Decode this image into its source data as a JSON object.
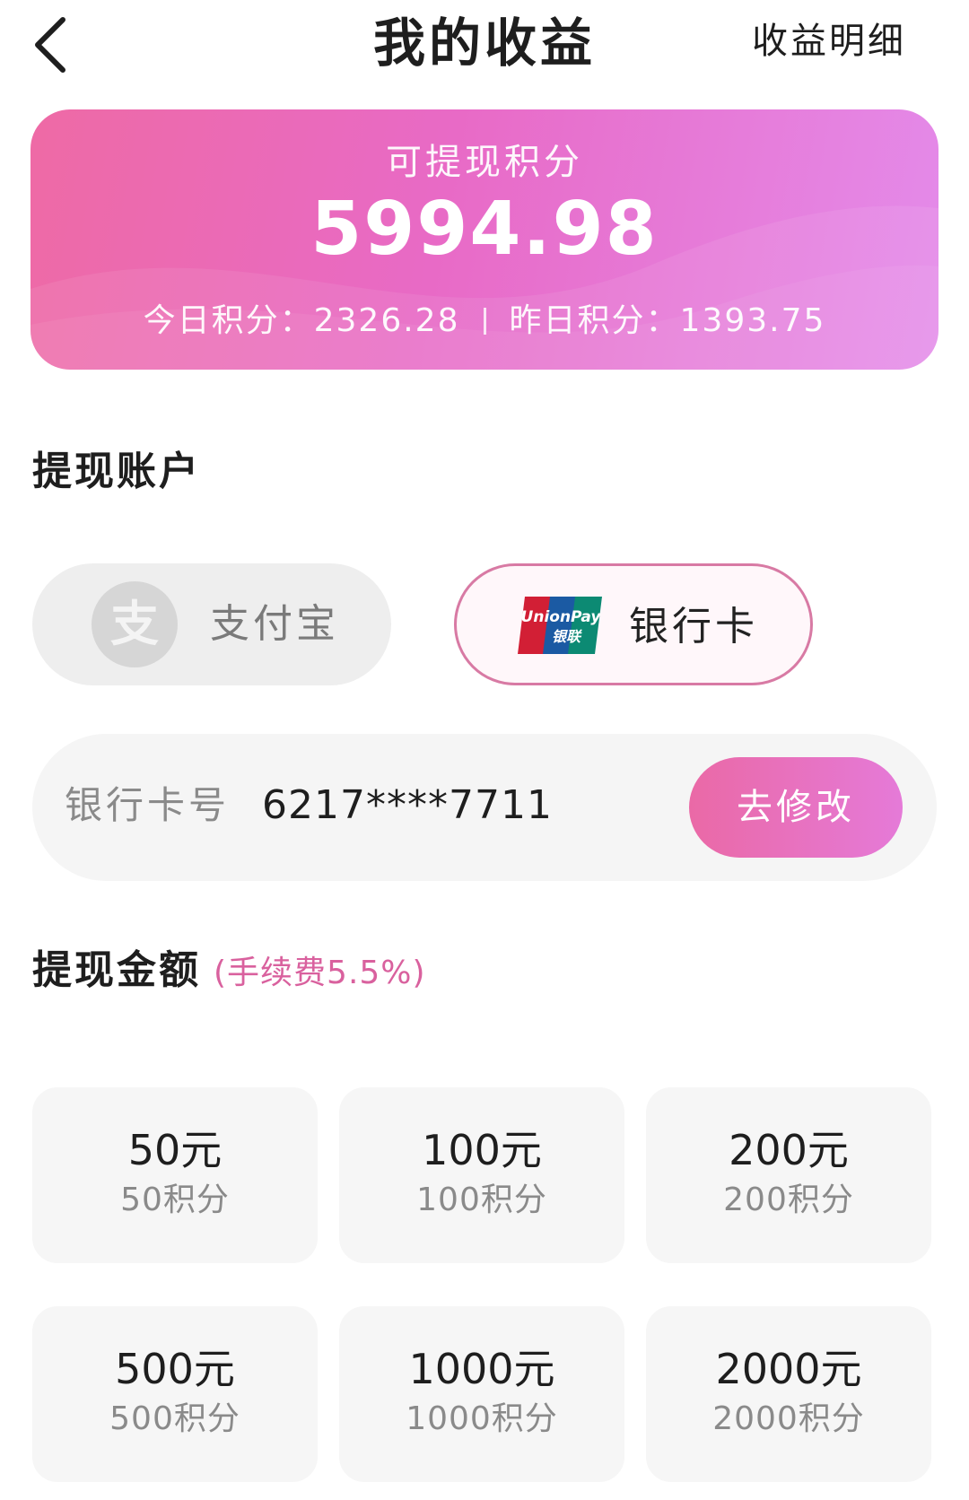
{
  "header": {
    "title": "我的收益",
    "detail_link": "收益明细"
  },
  "balance": {
    "label": "可提现积分",
    "value": "5994.98",
    "today_label": "今日积分：",
    "today_value": "2326.28",
    "yesterday_label": "昨日积分：",
    "yesterday_value": "1393.75"
  },
  "account": {
    "title": "提现账户",
    "options": [
      {
        "label": "支付宝",
        "icon": "alipay-icon",
        "selected": false
      },
      {
        "label": "银行卡",
        "icon": "unionpay-icon",
        "selected": true
      }
    ],
    "card_label": "银行卡号",
    "card_number": "6217****7711",
    "modify_button": "去修改"
  },
  "amount": {
    "title": "提现金额",
    "fee_note": "(手续费5.5%)",
    "items": [
      {
        "main": "50元",
        "sub": "50积分"
      },
      {
        "main": "100元",
        "sub": "100积分"
      },
      {
        "main": "200元",
        "sub": "200积分"
      },
      {
        "main": "500元",
        "sub": "500积分"
      },
      {
        "main": "1000元",
        "sub": "1000积分"
      },
      {
        "main": "2000元",
        "sub": "2000积分"
      }
    ]
  },
  "unionpay_logo": {
    "line1": "UnionPay",
    "line2": "银联"
  },
  "alipay_glyph": "支",
  "colors": {
    "accent": "#e86ac6",
    "card_gradient_start": "#ee6aa5",
    "card_gradient_end": "#e48bea",
    "fee_text": "#d9619e",
    "selected_border": "#d87aa4"
  }
}
